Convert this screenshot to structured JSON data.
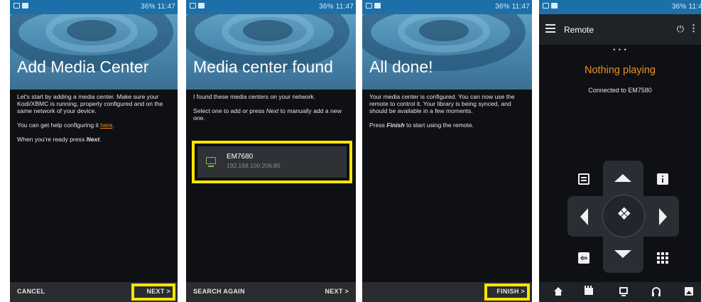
{
  "status_bar": {
    "right_text": "36% 11:47",
    "right_text_cut": "36% 11:4"
  },
  "screen1": {
    "title": "Add Media Center",
    "para1": "Let's start by adding a media center. Make sure your Kodi/XBMC is running, properly configured and on the same network of your device.",
    "para2_prefix": "You can get help configuring it ",
    "para2_link": "here",
    "para2_suffix": ".",
    "para3_prefix": "When you're ready press ",
    "para3_emph": "Next",
    "para3_suffix": ".",
    "cancel_label": "CANCEL",
    "next_label": "NEXT >"
  },
  "screen2": {
    "title": "Media center found",
    "para1": "I found these media centers on your network.",
    "para2_prefix": "Select one to add or press ",
    "para2_emph": "Next",
    "para2_suffix": " to manually add a new one.",
    "device_name": "EM7680",
    "device_ip": "192.168.100.206:80",
    "search_again_label": "SEARCH AGAIN",
    "next_label": "NEXT >"
  },
  "screen3": {
    "title": "All done!",
    "para1": "Your media center is configured. You can now use the remote to control it. Your library is being synced, and should be available in a few moments.",
    "para2_prefix": "Press ",
    "para2_emph": "Finish",
    "para2_suffix": " to start using the remote.",
    "finish_label": "FINISH >"
  },
  "screen4": {
    "app_title": "Remote",
    "page_dots": "• • •",
    "now_playing": "Nothing playing",
    "connected": "Connected to EM7580",
    "back_glyph": "⇦",
    "center_glyph": "❖"
  },
  "colors": {
    "status_bar": "#1c6fa8",
    "highlight": "#f5e600",
    "accent_orange": "#f0901e",
    "device_icon_green": "#7cc043",
    "background": "#0f1014"
  },
  "icons": [
    "notification-icon",
    "hamburger-menu-icon",
    "power-icon",
    "overflow-menu-icon",
    "device-icon",
    "arrow-up-icon",
    "arrow-down-icon",
    "arrow-left-icon",
    "arrow-right-icon",
    "select-icon",
    "playlist-icon",
    "info-icon",
    "back-icon",
    "grid-icon",
    "home-icon",
    "movies-icon",
    "tv-icon",
    "music-icon",
    "pictures-icon"
  ]
}
